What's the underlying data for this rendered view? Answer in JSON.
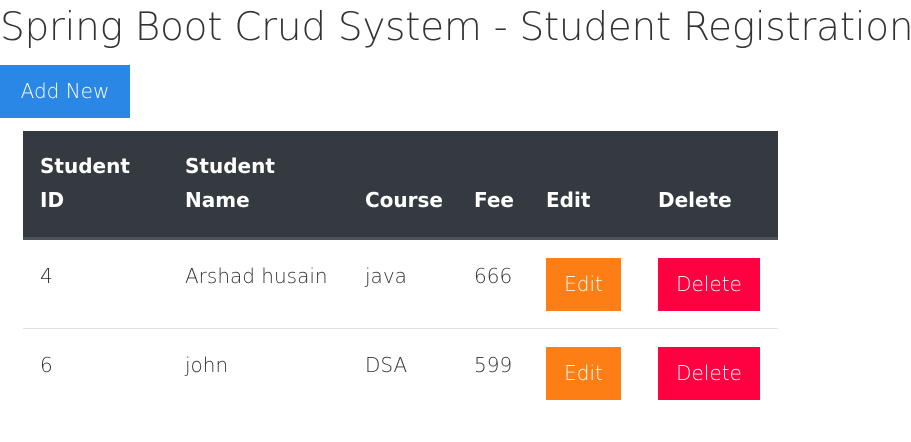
{
  "page": {
    "title": "Spring Boot Crud System - Student Registration"
  },
  "toolbar": {
    "add_label": "Add New"
  },
  "table": {
    "headers": {
      "id_line1": "Student",
      "id_line2": "ID",
      "name_line1": "Student",
      "name_line2": "Name",
      "course": "Course",
      "fee": "Fee",
      "edit": "Edit",
      "delete": "Delete"
    },
    "rows": [
      {
        "id": "4",
        "name": "Arshad husain",
        "course": "java",
        "fee": "666",
        "edit_label": "Edit",
        "delete_label": "Delete"
      },
      {
        "id": "6",
        "name": "john",
        "course": "DSA",
        "fee": "599",
        "edit_label": "Edit",
        "delete_label": "Delete"
      }
    ]
  },
  "colors": {
    "add_button": "#2a87e5",
    "header_bg": "#343a40",
    "edit_button": "#fd7e14",
    "delete_button": "#ff0040"
  }
}
